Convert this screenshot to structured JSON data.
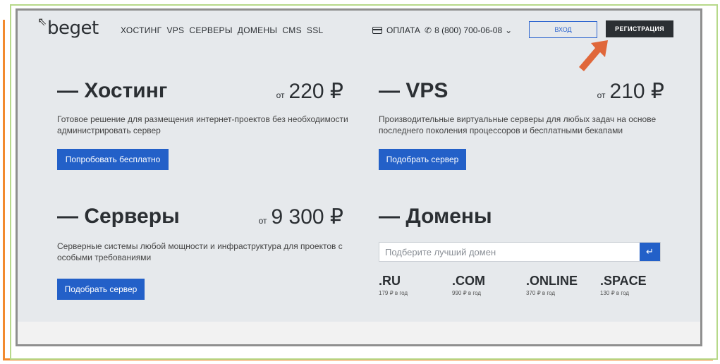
{
  "header": {
    "logo": "beget",
    "nav": [
      "ХОСТИНГ",
      "VPS",
      "СЕРВЕРЫ",
      "ДОМЕНЫ",
      "CMS",
      "SSL"
    ],
    "pay_label": "ОПЛАТА",
    "phone": "8 (800) 700-06-08",
    "login_label": "ВХОД",
    "register_label": "РЕГИСТРАЦИЯ"
  },
  "hosting": {
    "title": "— Хостинг",
    "price_prefix": "от",
    "price": "220 ₽",
    "desc": "Готовое решение для размещения интернет-проектов без необходимости администрировать сервер",
    "button": "Попробовать бесплатно"
  },
  "vps": {
    "title": "— VPS",
    "price_prefix": "от",
    "price": "210 ₽",
    "desc": "Производительные виртуальные серверы для любых задач на основе последнего поколения процессоров и бесплатными бекапами",
    "button": "Подобрать сервер"
  },
  "servers": {
    "title": "— Серверы",
    "price_prefix": "от",
    "price": "9 300 ₽",
    "desc": "Серверные системы любой мощности и инфраструктура для проектов с особыми требованиями",
    "button": "Подобрать сервер"
  },
  "domains": {
    "title": "— Домены",
    "placeholder": "Подберите лучший домен",
    "zones": [
      {
        "name": ".RU",
        "price": "179 ₽ в год"
      },
      {
        "name": ".COM",
        "price": "990 ₽ в год"
      },
      {
        "name": ".ONLINE",
        "price": "370 ₽ в год"
      },
      {
        "name": ".SPACE",
        "price": "130 ₽ в год"
      }
    ]
  },
  "colors": {
    "accent_blue": "#2360c8",
    "dark": "#2b2f33",
    "annotation_arrow": "#e0673a"
  }
}
